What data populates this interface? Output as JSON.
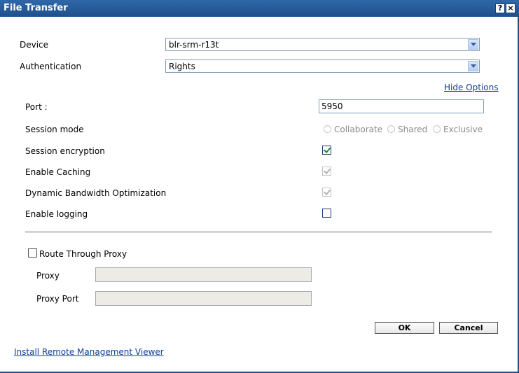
{
  "window": {
    "title": "File Transfer",
    "help_label": "?",
    "close_label": "×"
  },
  "form": {
    "device_label": "Device",
    "device_value": "blr-srm-r13t",
    "auth_label": "Authentication",
    "auth_value": "Rights",
    "hide_options_link": "Hide Options",
    "port_label": "Port :",
    "port_value": "5950",
    "session_mode_label": "Session mode",
    "session_modes": [
      {
        "label": "Collaborate",
        "selected": false,
        "disabled": true
      },
      {
        "label": "Shared",
        "selected": false,
        "disabled": true
      },
      {
        "label": "Exclusive",
        "selected": false,
        "disabled": true
      }
    ],
    "session_encryption_label": "Session encryption",
    "session_encryption_checked": true,
    "enable_caching_label": "Enable Caching",
    "enable_caching_checked": true,
    "dynamic_bandwidth_label": "Dynamic Bandwidth Optimization",
    "dynamic_bandwidth_checked": true,
    "enable_logging_label": "Enable logging",
    "enable_logging_checked": false,
    "route_proxy_label": "Route Through Proxy",
    "route_proxy_checked": false,
    "proxy_label": "Proxy",
    "proxy_value": "",
    "proxy_port_label": "Proxy Port",
    "proxy_port_value": ""
  },
  "buttons": {
    "ok_label": "OK",
    "cancel_label": "Cancel"
  },
  "footer": {
    "install_link": "Install Remote Management Viewer"
  }
}
